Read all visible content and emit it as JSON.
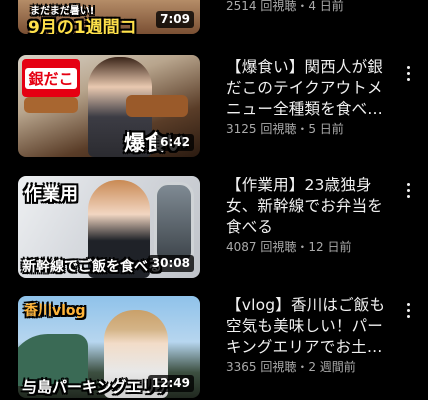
{
  "videos": [
    {
      "overlay": "9月の1週間コ",
      "overlay_small": "まだまだ暑い!",
      "duration": "7:09",
      "title": "",
      "meta": "2514 回視聴・4 日前"
    },
    {
      "overlay": "爆食い",
      "logo": "銀だこ",
      "duration": "6:42",
      "title": "【爆食い】関西人が銀だこのテイクアウトメニュー全種類を食べ…",
      "meta": "3125 回視聴・5 日前"
    },
    {
      "overlay_top": "作業用",
      "overlay": "新幹線でご飯を食べる",
      "duration": "30:08",
      "title": "【作業用】23歳独身女、新幹線でお弁当を食べる",
      "meta": "4087 回視聴・12 日前"
    },
    {
      "overlay_top": "香川vlog",
      "overlay": "与島パーキングエリア",
      "duration": "12:49",
      "title": "【vlog】香川はご飯も空気も美味しい！パーキングエリアでお土…",
      "meta": "3365 回視聴・2 週間前"
    }
  ]
}
